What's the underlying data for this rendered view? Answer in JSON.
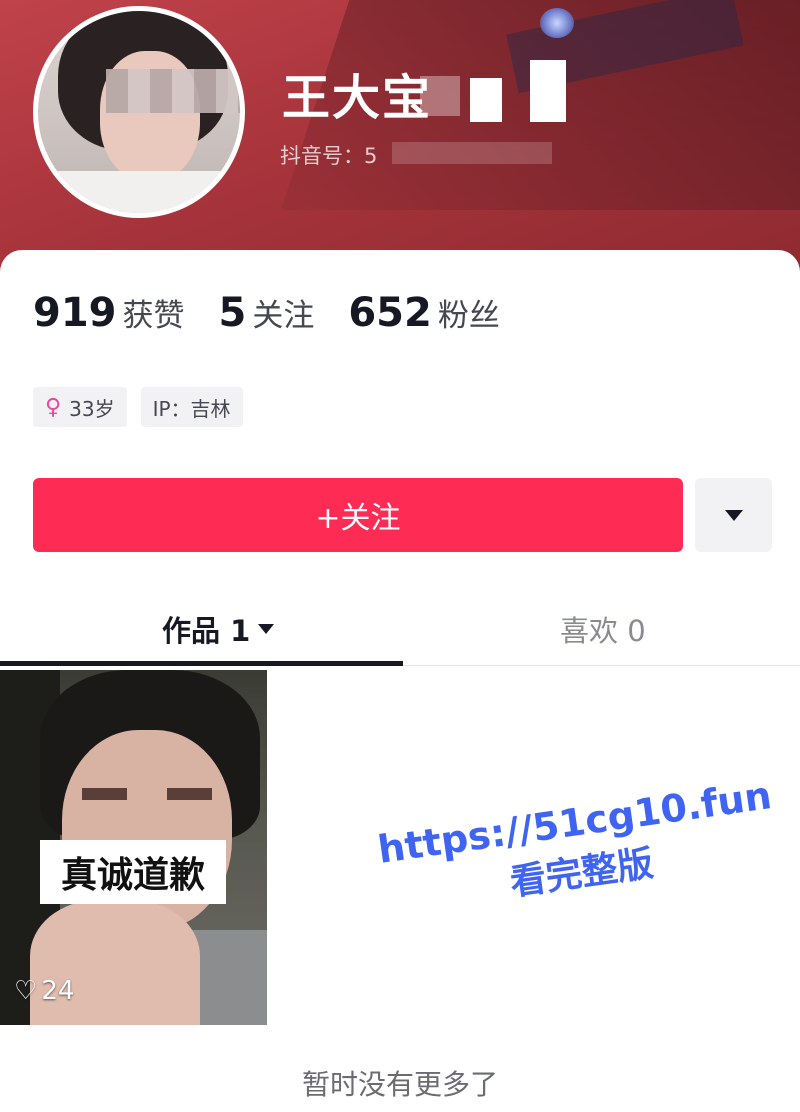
{
  "profile": {
    "username": "王大宝",
    "douyin_id_label": "抖音号：5",
    "avatar": "avatar-photo"
  },
  "stats": [
    {
      "value": "919",
      "label": "获赞"
    },
    {
      "value": "5",
      "label": "关注"
    },
    {
      "value": "652",
      "label": "粉丝"
    }
  ],
  "tags": {
    "age": "33岁",
    "age_icon": "female-icon",
    "ip": "IP：吉林"
  },
  "actions": {
    "follow_label": "+关注",
    "more_icon": "triangle-down-icon"
  },
  "tabs": {
    "works_label": "作品 1",
    "likes_label": "喜欢 0"
  },
  "video": {
    "caption": "真诚道歉",
    "likes": "24",
    "heart_icon": "heart-outline-icon"
  },
  "watermark": {
    "url": "https://51cg10.fun",
    "sub": "看完整版"
  },
  "footer": {
    "no_more": "暂时没有更多了"
  },
  "colors": {
    "accent": "#fe2c55",
    "header": "#a8343c",
    "watermark": "#3f64f2"
  }
}
